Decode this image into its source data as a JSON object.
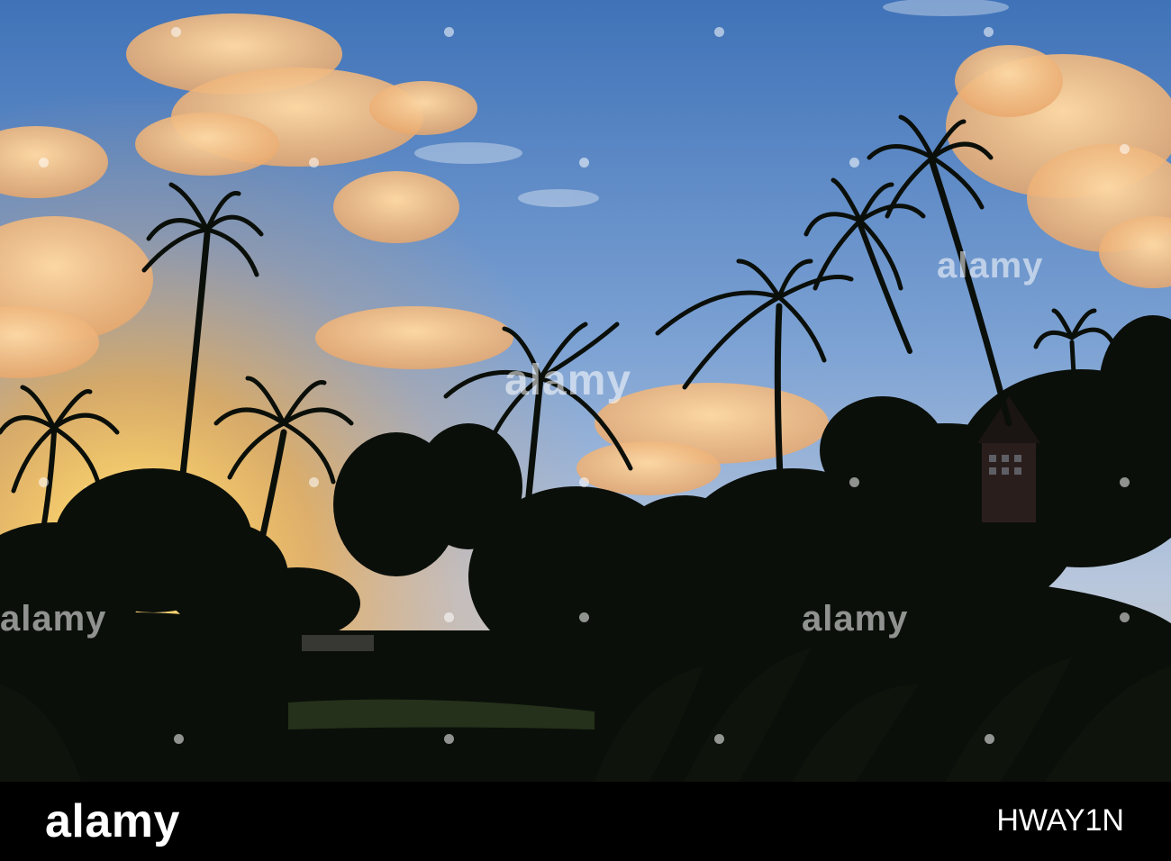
{
  "watermark": {
    "text": "alamy"
  },
  "footer": {
    "logo": "alamy",
    "image_code": "HWAY1N"
  },
  "colors": {
    "sky_top": "#4f7fbf",
    "sky_mid": "#8eaed6",
    "sunset_glow": "#f5b84a",
    "sun_core": "#fff6c8",
    "cloud": "#f2c087",
    "silhouette": "#0b0f0a",
    "footer_bg": "#000000"
  }
}
